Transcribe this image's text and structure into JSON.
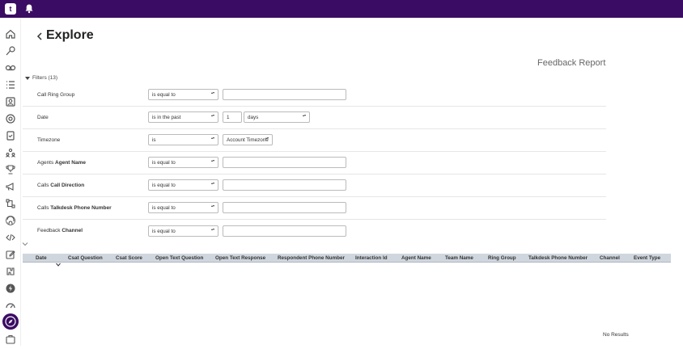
{
  "topbar": {
    "logo_text": "t",
    "icons": [
      "app-logo-icon",
      "bell-icon"
    ]
  },
  "sidebar": {
    "items": [
      "home-icon",
      "routing-icon",
      "voicemail-icon",
      "list-icon",
      "contacts-icon",
      "support-icon",
      "checklist-icon",
      "team-icon",
      "trophy-icon",
      "campaign-icon",
      "flow-icon",
      "fingerprint-icon",
      "code-icon",
      "edit-icon",
      "integrations-icon",
      "power-icon",
      "gauge-icon",
      "explore-icon",
      "briefcase-icon"
    ],
    "active": "explore-icon"
  },
  "header": {
    "title": "Explore",
    "report_title": "Feedback Report"
  },
  "filters": {
    "toggle_label": "Filters (13)",
    "rows": [
      {
        "label_prefix": "",
        "label_bold": "",
        "label_plain": "Call Ring Group",
        "operator": "is equal to",
        "value": ""
      },
      {
        "label_prefix": "",
        "label_bold": "",
        "label_plain": "Date",
        "operator": "is in the past",
        "value": "1",
        "unit": "days"
      },
      {
        "label_prefix": "",
        "label_bold": "",
        "label_plain": "Timezone",
        "operator": "is",
        "value": "Account Timezone"
      },
      {
        "label_prefix": "Agents ",
        "label_bold": "Agent Name",
        "label_plain": "",
        "operator": "is equal to",
        "value": ""
      },
      {
        "label_prefix": "Calls ",
        "label_bold": "Call Direction",
        "label_plain": "",
        "operator": "is equal to",
        "value": ""
      },
      {
        "label_prefix": "Calls ",
        "label_bold": "Talkdesk Phone Number",
        "label_plain": "",
        "operator": "is equal to",
        "value": ""
      },
      {
        "label_prefix": "Feedback ",
        "label_bold": "Channel",
        "label_plain": "",
        "operator": "is equal to",
        "value": ""
      }
    ]
  },
  "table": {
    "columns": [
      "Date",
      "Csat Question",
      "Csat Score",
      "Open Text Question",
      "Open Text Response",
      "Respondent Phone Number",
      "Interaction Id",
      "Agent Name",
      "Team Name",
      "Ring Group",
      "Talkdesk Phone Number",
      "Channel",
      "Event Type"
    ],
    "empty_text": "No Results"
  }
}
